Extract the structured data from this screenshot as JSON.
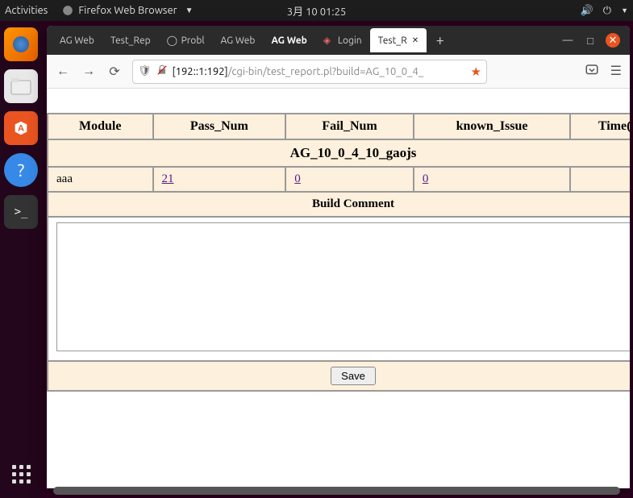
{
  "topbar": {
    "activities": "Activities",
    "app_name": "Firefox Web Browser",
    "clock": "3月 10  01:25"
  },
  "tabs": [
    {
      "label": "AG Web"
    },
    {
      "label": "Test_Rep"
    },
    {
      "label": "Probl"
    },
    {
      "label": "AG Web"
    },
    {
      "label": "AG Web"
    },
    {
      "label": "Login"
    },
    {
      "label": "Test_R"
    }
  ],
  "url": {
    "domain": "[192::1:192]",
    "path": "/cgi-bin/test_report.pl?build=AG_10_0_4_"
  },
  "report": {
    "title": "AG_10_0_4_10_gaojs",
    "headers": [
      "Module",
      "Pass_Num",
      "Fail_Num",
      "known_Issue",
      "Time("
    ],
    "rows": [
      {
        "module": "aaa",
        "pass": "21",
        "fail": "0",
        "known": "0",
        "time": ""
      }
    ],
    "comment_header": "Build Comment",
    "comment_value": "",
    "save_label": "Save"
  }
}
